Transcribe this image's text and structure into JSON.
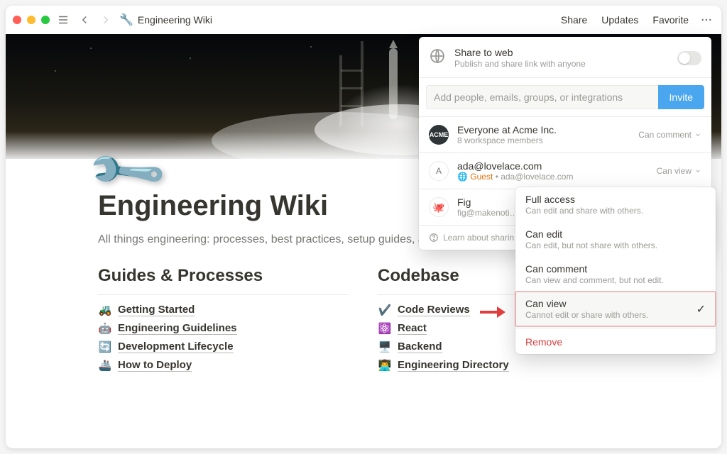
{
  "toolbar": {
    "title": "Engineering Wiki",
    "actions": {
      "share": "Share",
      "updates": "Updates",
      "favorite": "Favorite"
    }
  },
  "page": {
    "icon_emoji": "🔧",
    "title": "Engineering Wiki",
    "description": "All things engineering: processes, best practices, setup guides, and more!",
    "sections": [
      {
        "heading": "Guides & Processes",
        "items": [
          {
            "emoji": "🚜",
            "label": "Getting Started"
          },
          {
            "emoji": "🤖",
            "label": "Engineering Guidelines"
          },
          {
            "emoji": "🔄",
            "label": "Development Lifecycle"
          },
          {
            "emoji": "🚢",
            "label": "How to Deploy"
          }
        ]
      },
      {
        "heading": "Codebase",
        "items": [
          {
            "emoji": "✔️",
            "label": "Code Reviews"
          },
          {
            "emoji": "⚛️",
            "label": "React"
          },
          {
            "emoji": "🖥️",
            "label": "Backend"
          },
          {
            "emoji": "👨‍💻",
            "label": "Engineering Directory"
          }
        ]
      }
    ]
  },
  "share": {
    "web": {
      "title": "Share to web",
      "sub": "Publish and share link with anyone",
      "enabled": false
    },
    "invite": {
      "placeholder": "Add people, emails, groups, or integrations",
      "button": "Invite"
    },
    "rows": [
      {
        "avatar": "ACME",
        "kind": "acme",
        "name": "Everyone at Acme Inc.",
        "sub": "8 workspace members",
        "perm": "Can comment"
      },
      {
        "avatar": "A",
        "kind": "ring",
        "name": "ada@lovelace.com",
        "guest": "Guest",
        "sub_extra": "ada@lovelace.com",
        "perm": "Can view"
      },
      {
        "avatar": "fig",
        "kind": "fig",
        "name": "Fig",
        "sub": "fig@makenoti…",
        "perm": ""
      }
    ],
    "learn": "Learn about sharin"
  },
  "perm_menu": {
    "options": [
      {
        "t": "Full access",
        "d": "Can edit and share with others."
      },
      {
        "t": "Can edit",
        "d": "Can edit, but not share with others."
      },
      {
        "t": "Can comment",
        "d": "Can view and comment, but not edit."
      },
      {
        "t": "Can view",
        "d": "Cannot edit or share with others.",
        "selected": true
      }
    ],
    "remove": "Remove"
  }
}
